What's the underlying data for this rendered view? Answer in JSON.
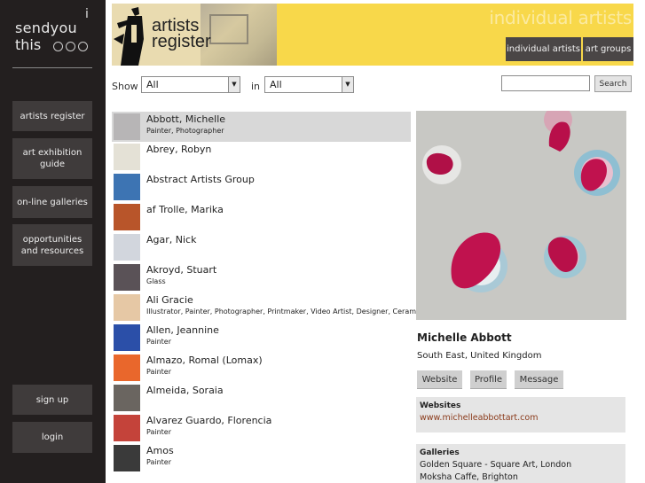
{
  "sidebar": {
    "logo_i": "i",
    "logo_line1": "sendyou",
    "logo_line2": "this",
    "nav": [
      {
        "label": "artists register"
      },
      {
        "label": "art exhibition guide"
      },
      {
        "label": "on-line galleries"
      },
      {
        "label": "opportunities and resources"
      }
    ],
    "signup": "sign up",
    "login": "login"
  },
  "header": {
    "brand_line1": "artists",
    "brand_line2": "register",
    "section_title": "individual artists",
    "tabs": [
      "individual artists",
      "art groups"
    ]
  },
  "filter": {
    "show_label": "Show",
    "show_value": "All",
    "in_label": "in",
    "in_value": "All",
    "search_value": "",
    "search_button": "Search"
  },
  "artists": [
    {
      "name": "Abbott, Michelle",
      "disciplines": "Painter, Photographer",
      "thumb": "#b7b5b6"
    },
    {
      "name": "Abrey, Robyn",
      "disciplines": "",
      "thumb": "#e4e1d6"
    },
    {
      "name": "Abstract Artists Group",
      "disciplines": "",
      "thumb": "#3d74b3"
    },
    {
      "name": "af Trolle, Marika",
      "disciplines": "",
      "thumb": "#b8552a"
    },
    {
      "name": "Agar, Nick",
      "disciplines": "",
      "thumb": "#d2d6dd"
    },
    {
      "name": "Akroyd, Stuart",
      "disciplines": "Glass",
      "thumb": "#5a5257"
    },
    {
      "name": "Ali Gracie",
      "disciplines": "Illustrator, Painter, Photographer, Printmaker, Video Artist, Designer, Ceramicist",
      "thumb": "#e6c8a5"
    },
    {
      "name": "Allen, Jeannine",
      "disciplines": "Painter",
      "thumb": "#2b4fa8"
    },
    {
      "name": "Almazo, Romal (Lomax)",
      "disciplines": "Painter",
      "thumb": "#e9672c"
    },
    {
      "name": "Almeida, Soraia",
      "disciplines": "",
      "thumb": "#6a6560"
    },
    {
      "name": "Alvarez Guardo, Florencia",
      "disciplines": "Painter",
      "thumb": "#c4433a"
    },
    {
      "name": "Amos",
      "disciplines": "Painter",
      "thumb": "#3a3a3a"
    }
  ],
  "detail": {
    "name": "Michelle Abbott",
    "location": "South East, United Kingdom",
    "buttons": [
      "Website",
      "Profile",
      "Message"
    ],
    "websites_heading": "Websites",
    "website_link": "www.michelleabbottart.com",
    "galleries_heading": "Galleries",
    "galleries": [
      "Golden Square - Square Art, London",
      "Moksha Caffe, Brighton"
    ]
  }
}
